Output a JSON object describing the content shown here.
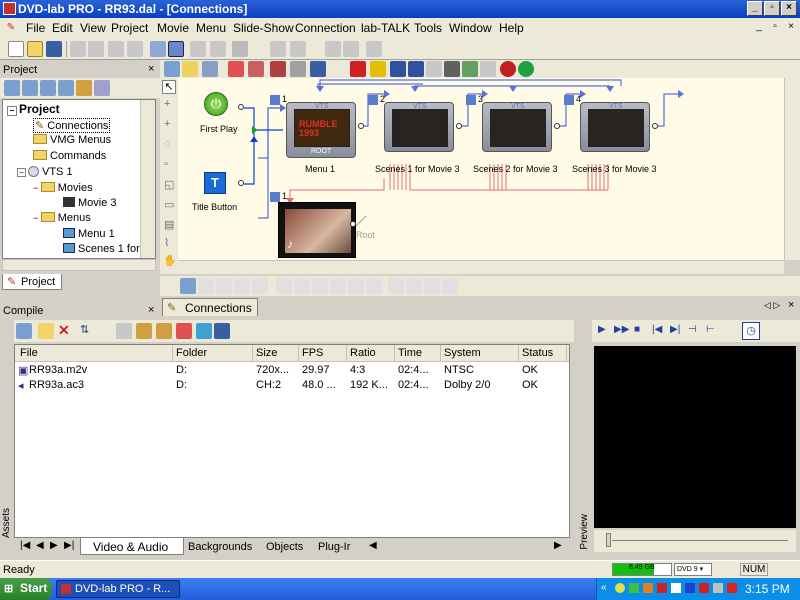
{
  "app": {
    "title": "DVD-lab PRO - RR93.dal - [Connections]"
  },
  "menus": [
    "File",
    "Edit",
    "View",
    "Project",
    "Movie",
    "Menu",
    "Slide-Show",
    "Connection",
    "lab-TALK",
    "Tools",
    "Window",
    "Help"
  ],
  "project_panel": {
    "title": "Project",
    "tree": [
      {
        "label": "Project",
        "level": 0
      },
      {
        "label": "Connections",
        "level": 1
      },
      {
        "label": "VMG Menus",
        "level": 1
      },
      {
        "label": "Commands",
        "level": 1
      },
      {
        "label": "VTS 1",
        "level": 1
      },
      {
        "label": "Movies",
        "level": 2
      },
      {
        "label": "Movie 3",
        "level": 3
      },
      {
        "label": "Menus",
        "level": 2
      },
      {
        "label": "Menu 1",
        "level": 3
      },
      {
        "label": "Scenes 1 for",
        "level": 3
      }
    ],
    "tab": "Project"
  },
  "connections": {
    "tab": "Connections",
    "first_play": "First Play",
    "title_button": "Title Button",
    "root_label": "ROOT",
    "root_caption": "Root",
    "thumb_tag": "VTS",
    "nodes": [
      {
        "num": "1",
        "label": "Menu 1"
      },
      {
        "num": "2",
        "label": "Scenes 1 for Movie 3"
      },
      {
        "num": "3",
        "label": "Scenes 2 for Movie 3"
      },
      {
        "num": "4",
        "label": "Scenes 3 for Movie 3"
      }
    ],
    "movie": {
      "num": "1",
      "logo": "RUMBLE 1993"
    }
  },
  "compile_panel": {
    "title": "Compile"
  },
  "assets": {
    "side_label": "Assets",
    "columns": [
      "File",
      "Folder",
      "Size",
      "FPS",
      "Ratio",
      "Time",
      "System",
      "Status"
    ],
    "rows": [
      [
        "RR93a.m2v",
        "D:",
        "720x...",
        "29.97",
        "4:3",
        "02:4...",
        "NTSC",
        "OK"
      ],
      [
        "RR93a.ac3",
        "D:",
        "CH:2",
        "48.0 ...",
        "192 K...",
        "02:4...",
        "Dolby 2/0",
        "OK"
      ]
    ],
    "tabs": [
      "Video & Audio",
      "Backgrounds",
      "Objects",
      "Plug-Ir"
    ]
  },
  "preview": {
    "side_label": "Preview"
  },
  "status": {
    "text": "Ready",
    "disk": "8.49 GB",
    "disk_fill": 0.7,
    "format": "DVD 9",
    "num": "NUM"
  },
  "taskbar": {
    "start": "Start",
    "task": "DVD-lab PRO - R...",
    "clock": "3:15 PM"
  },
  "colors": {
    "titlebar": "#0a3fbf",
    "canvas": "#fffbe6",
    "arrow_blue": "#5a6fd8",
    "arrow_red": "#e07070",
    "disk_green": "#10c010"
  }
}
